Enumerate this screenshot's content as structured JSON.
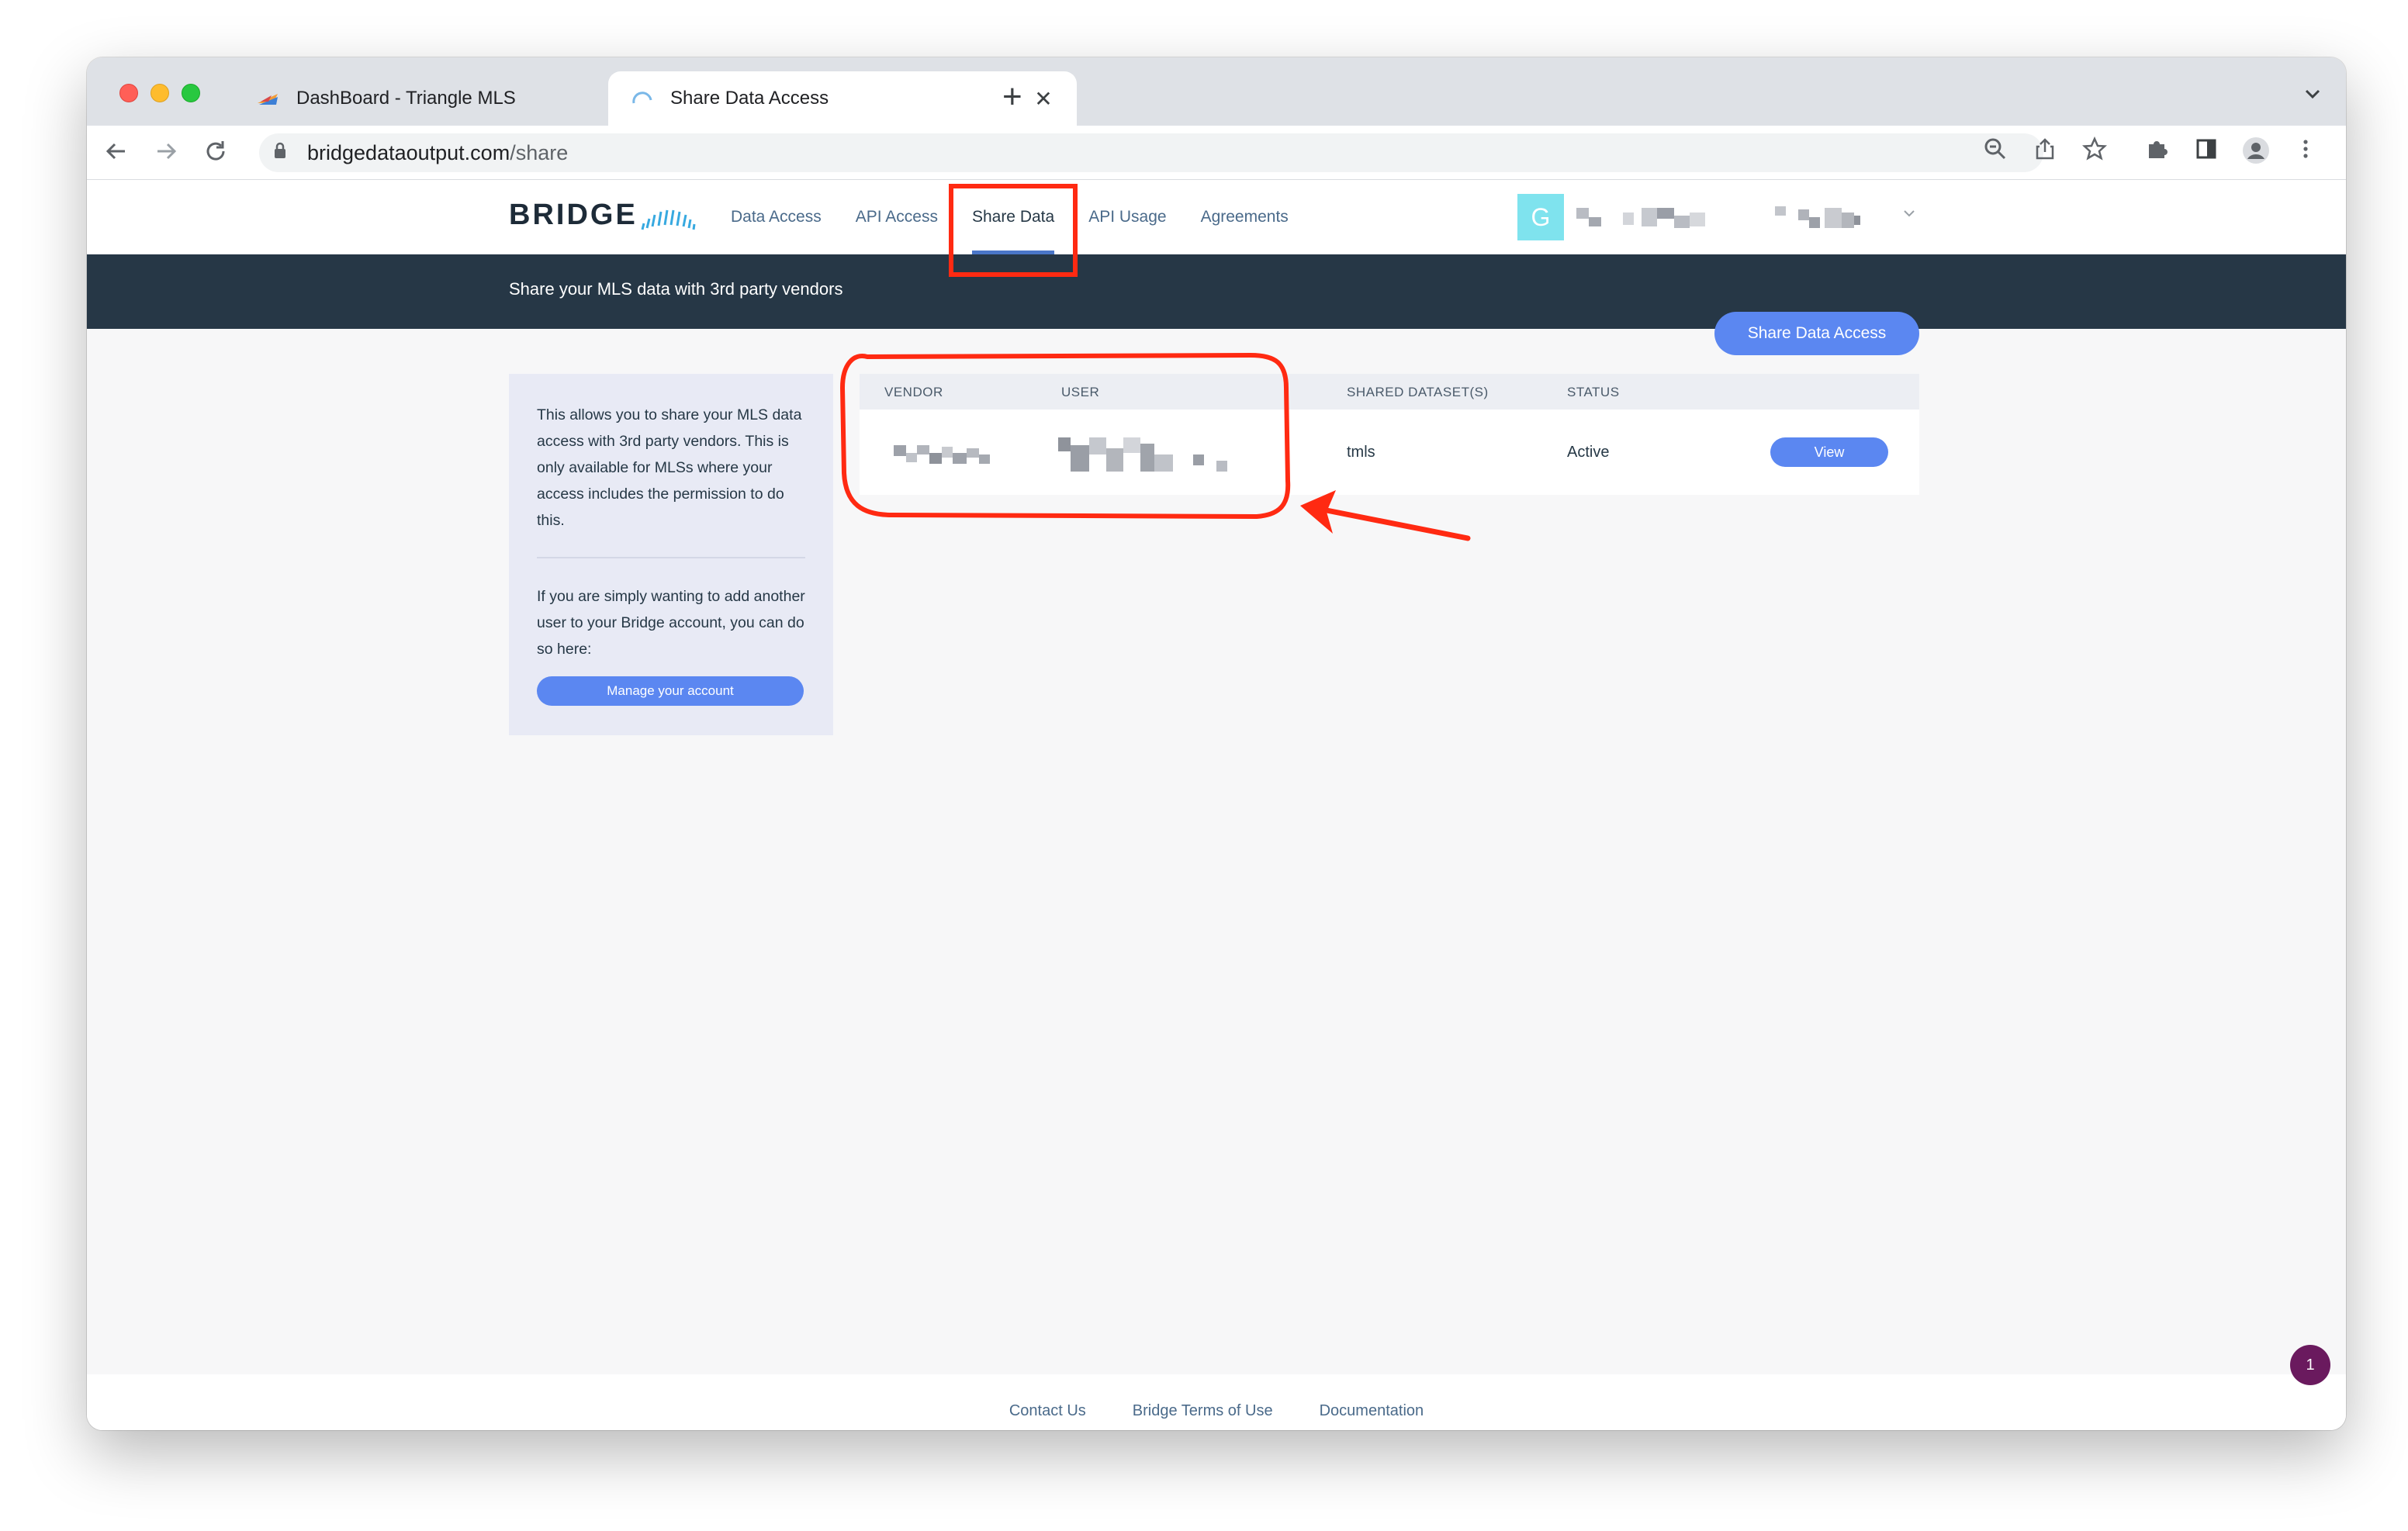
{
  "browser": {
    "tabs": [
      {
        "title": "DashBoard - Triangle MLS",
        "active": false,
        "close": "✕"
      },
      {
        "title": "Share Data Access",
        "active": true,
        "close": "✕"
      }
    ],
    "new_tab": "+",
    "tab_menu": "⌄",
    "url_host": "bridgedataoutput.com",
    "url_path": "/share"
  },
  "app": {
    "logo": "BRIDGE",
    "nav": [
      "Data Access",
      "API Access",
      "Share Data",
      "API Usage",
      "Agreements"
    ],
    "active_nav": "Share Data",
    "avatar_letter": "G"
  },
  "banner": {
    "text": "Share your MLS data with 3rd party vendors"
  },
  "share_button": "Share Data Access",
  "info": {
    "paragraph1": "This allows you to share your MLS data access with 3rd party vendors. This is only available for MLSs where your access includes the permission to do this.",
    "paragraph2": "If you are simply wanting to add another user to your Bridge account, you can do so here:",
    "button": "Manage your account"
  },
  "table": {
    "headers": [
      "VENDOR",
      "USER",
      "SHARED DATASET(S)",
      "STATUS"
    ],
    "rows": [
      {
        "dataset": "tmls",
        "status": "Active",
        "action": "View"
      }
    ]
  },
  "footer": {
    "links": [
      "Contact Us",
      "Bridge Terms of Use",
      "Documentation"
    ]
  },
  "notification_count": "1",
  "colors": {
    "accent": "#5b87f1",
    "banner": "#263746",
    "annotation": "#ff2a12"
  }
}
